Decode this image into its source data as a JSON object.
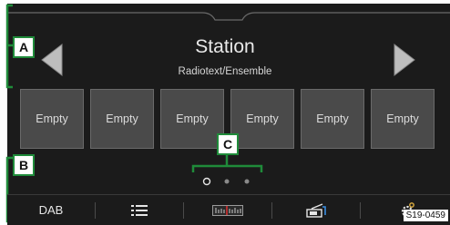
{
  "station": {
    "title": "Station",
    "subtitle": "Radiotext/Ensemble"
  },
  "presets": [
    {
      "label": "Empty"
    },
    {
      "label": "Empty"
    },
    {
      "label": "Empty"
    },
    {
      "label": "Empty"
    },
    {
      "label": "Empty"
    },
    {
      "label": "Empty"
    }
  ],
  "callouts": {
    "a": "A",
    "b": "B",
    "c": "C"
  },
  "page_indicator": {
    "pages": 3,
    "active_index": 0
  },
  "bottom_bar": {
    "source_label": "DAB",
    "icons": [
      "list-icon",
      "frequency-band-icon",
      "slideshow-icon",
      "settings-icon"
    ]
  },
  "figure_ref": "S19-0459",
  "colors": {
    "screen_bg": "#1b1b1b",
    "preset_bg": "#4a4a4a",
    "callout_green": "#1f8b3a",
    "text": "#e9e9e9"
  }
}
